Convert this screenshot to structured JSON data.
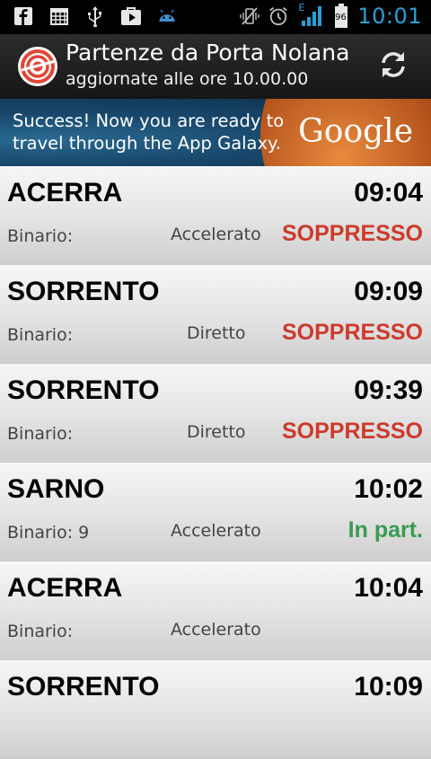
{
  "status_bar": {
    "time": "10:01",
    "battery_level": "96",
    "network_type": "E",
    "left_icons": [
      "facebook-icon",
      "calendar-icon",
      "usb-icon",
      "play-store-icon",
      "android-debug-icon"
    ],
    "right_icons": [
      "vibrate-icon",
      "alarm-icon",
      "signal-icon",
      "battery-icon"
    ]
  },
  "header": {
    "title": "Partenze da Porta Nolana",
    "subtitle": "aggiornate alle ore 10.00.00",
    "logo_icon": "eav-logo-icon",
    "refresh_icon": "refresh-icon"
  },
  "ad": {
    "line1": "Success! Now you are ready to",
    "line2": "travel through the App Galaxy.",
    "brand": "Google"
  },
  "colors": {
    "cancelled": "#cc3a2c",
    "departing": "#3a9a52",
    "time_accent": "#2a9fd6"
  },
  "departures": [
    {
      "destination": "ACERRA",
      "time": "09:04",
      "platform": "Binario:",
      "train_type": "Accelerato",
      "status": "SOPPRESSO",
      "status_kind": "cancelled"
    },
    {
      "destination": "SORRENTO",
      "time": "09:09",
      "platform": "Binario:",
      "train_type": "Diretto",
      "status": "SOPPRESSO",
      "status_kind": "cancelled"
    },
    {
      "destination": "SORRENTO",
      "time": "09:39",
      "platform": "Binario:",
      "train_type": "Diretto",
      "status": "SOPPRESSO",
      "status_kind": "cancelled"
    },
    {
      "destination": "SARNO",
      "time": "10:02",
      "platform": "Binario: 9",
      "train_type": "Accelerato",
      "status": "In part.",
      "status_kind": "departing"
    },
    {
      "destination": "ACERRA",
      "time": "10:04",
      "platform": "Binario:",
      "train_type": "Accelerato",
      "status": "",
      "status_kind": "none"
    },
    {
      "destination": "SORRENTO",
      "time": "10:09",
      "platform": "",
      "train_type": "",
      "status": "",
      "status_kind": "none"
    }
  ]
}
